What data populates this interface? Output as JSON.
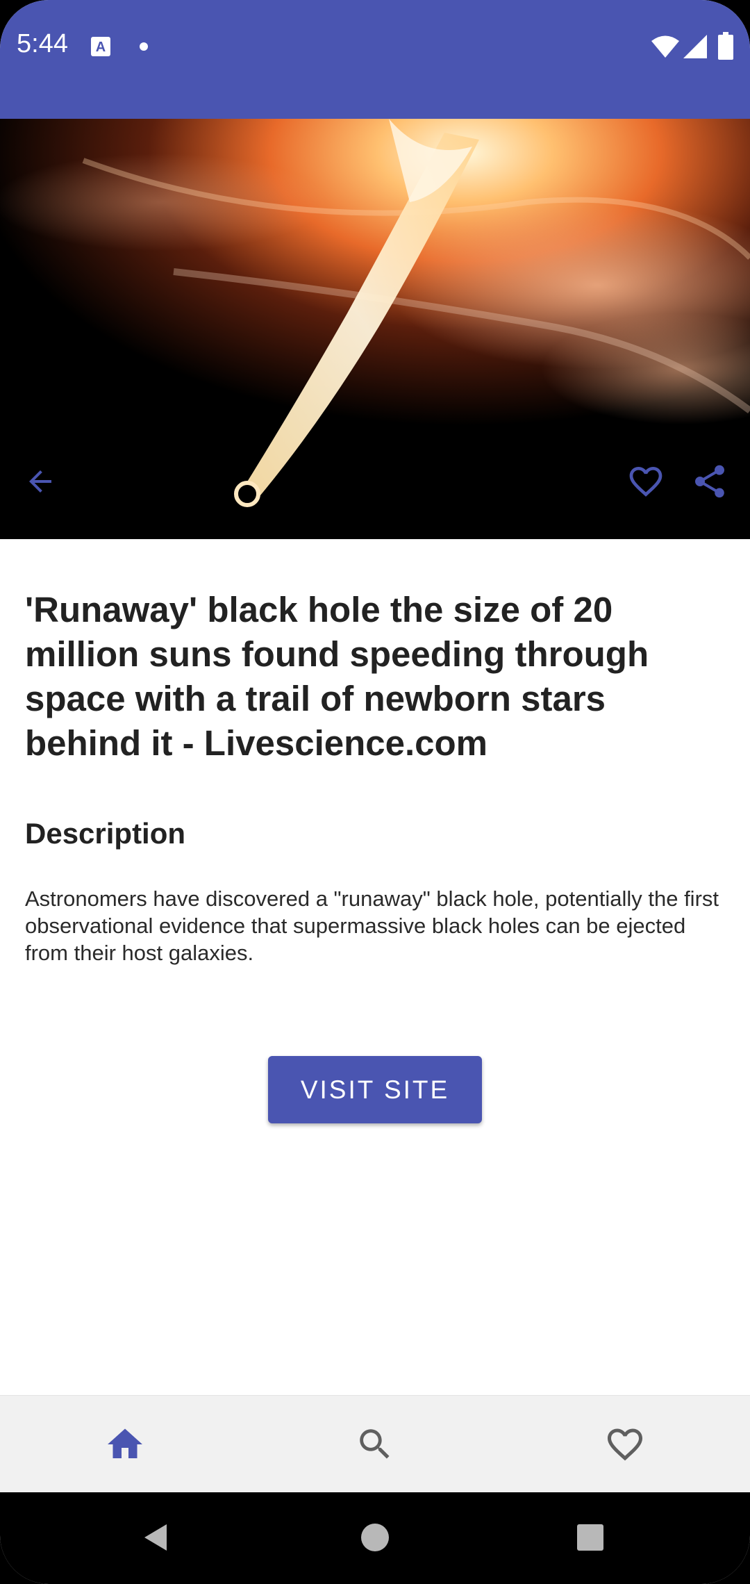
{
  "status_bar": {
    "time": "5:44",
    "icons": [
      "keyboard-a-icon",
      "dot-icon",
      "wifi-icon",
      "signal-icon",
      "battery-icon"
    ]
  },
  "hero": {
    "image": "black-hole-trail-image",
    "back_icon": "arrow-back-icon",
    "favorite_icon": "heart-outline-icon",
    "share_icon": "share-icon"
  },
  "article": {
    "title": "'Runaway' black hole the size of 20 million suns found speeding through space with a trail of newborn stars behind it - Livescience.com",
    "description_heading": "Description",
    "description": "Astronomers have discovered a \"runaway\" black hole, potentially the first observational evidence that supermassive black holes can be ejected from their host galaxies."
  },
  "actions": {
    "visit_label": "VISIT SITE"
  },
  "bottom_nav": {
    "items": [
      {
        "icon": "home-icon",
        "active": true
      },
      {
        "icon": "search-icon",
        "active": false
      },
      {
        "icon": "heart-outline-icon",
        "active": false
      }
    ]
  },
  "system_nav": {
    "icons": [
      "back-triangle-icon",
      "home-circle-icon",
      "recents-square-icon"
    ]
  },
  "colors": {
    "primary": "#4a55b1",
    "nav_background": "#f1f1f1",
    "icon_inactive": "#5f5f5f"
  }
}
